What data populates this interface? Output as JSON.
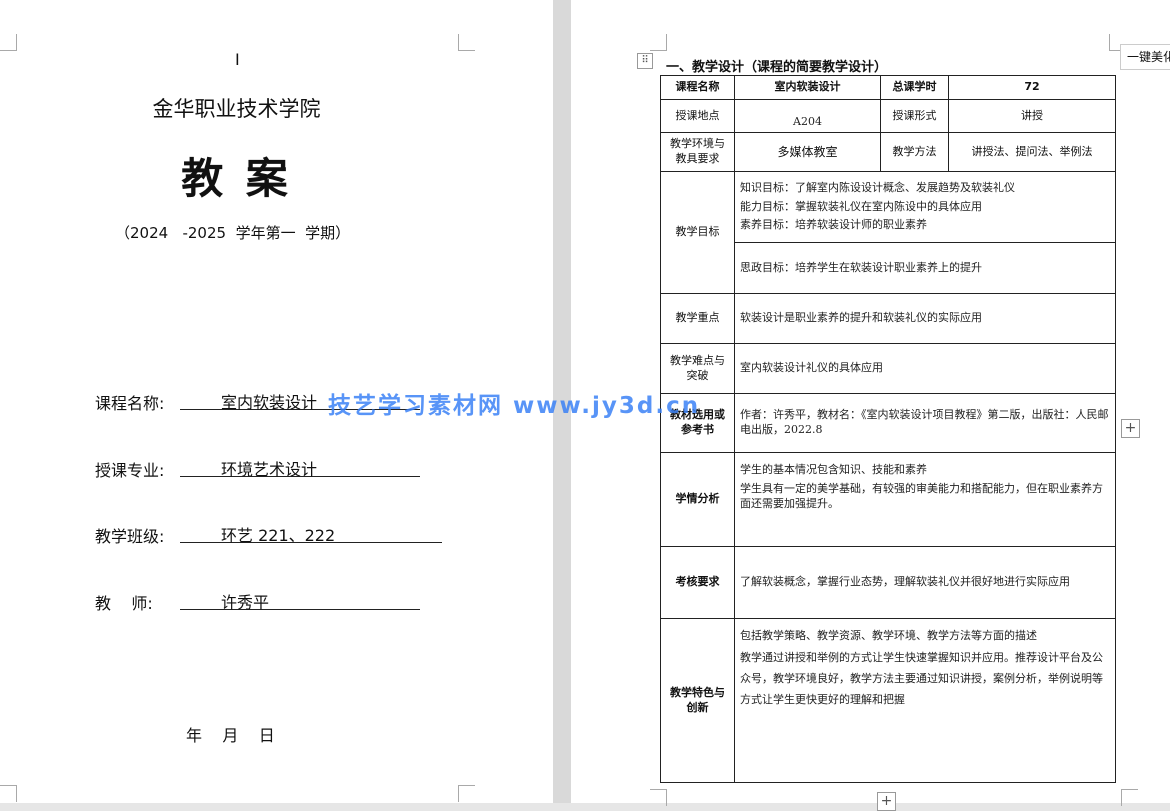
{
  "cover": {
    "cursor_mark": "I",
    "school": "金华职业技术学院",
    "doc_title": "教 案",
    "term": "（2024   -2025  学年第一  学期）",
    "fields": [
      {
        "label": "课程名称:",
        "value": "室内软装设计"
      },
      {
        "label": "授课专业:",
        "value": "环境艺术设计"
      },
      {
        "label": "教学班级:",
        "value": "环艺 221、222"
      },
      {
        "label": "教    师:",
        "value": "许秀平"
      }
    ],
    "date_line": "年    月    日"
  },
  "watermark": "技艺学习素材网   www.jy3d.cn",
  "plan": {
    "heading": "一、教学设计（课程的简要教学设计）",
    "row1": {
      "course_label": "课程名称",
      "course_value": "室内软装设计",
      "hours_label": "总课学时",
      "hours_value": "72"
    },
    "row2": {
      "place_label": "授课地点",
      "place_value": "A204",
      "form_label": "授课形式",
      "form_value": "讲授"
    },
    "row3": {
      "env_label": "教学环境与教具要求",
      "env_value": "多媒体教室",
      "method_label": "教学方法",
      "method_value": "讲授法、提问法、举例法"
    },
    "objectives": {
      "label": "教学目标",
      "lines": [
        "知识目标：了解室内陈设设计概念、发展趋势及软装礼仪",
        "能力目标：掌握软装礼仪在室内陈设中的具体应用",
        "素养目标：培养软装设计师的职业素养"
      ],
      "ideology": "思政目标：培养学生在软装设计职业素养上的提升"
    },
    "key_points": {
      "label": "教学重点",
      "text": "软装设计是职业素养的提升和软装礼仪的实际应用"
    },
    "difficulties": {
      "label": "教学难点与突破",
      "text": "室内软装设计礼仪的具体应用"
    },
    "textbook": {
      "label": "教材选用或参考书",
      "text": "作者：许秀平，教材名：《室内软装设计项目教程》第二版，出版社：人民邮电出版，2022.8"
    },
    "analysis": {
      "label": "学情分析",
      "lines": [
        "学生的基本情况包含知识、技能和素养",
        "学生具有一定的美学基础，有较强的审美能力和搭配能力，但在职业素养方面还需要加强提升。"
      ]
    },
    "assessment": {
      "label": "考核要求",
      "text": "了解软装概念，掌握行业态势，理解软装礼仪并很好地进行实际应用"
    },
    "features": {
      "label": "教学特色与创新",
      "lines": [
        "包括教学策略、教学资源、教学环境、教学方法等方面的描述",
        "教学通过讲授和举例的方式让学生快速掌握知识并应用。推荐设计平台及公众号，教学环境良好，教学方法主要通过知识讲授，案例分析，举例说明等方式让学生更快更好的理解和把握"
      ]
    }
  },
  "side_tab_label": "一键美化",
  "handle_glyph": "⠿",
  "plus_glyph": "+"
}
